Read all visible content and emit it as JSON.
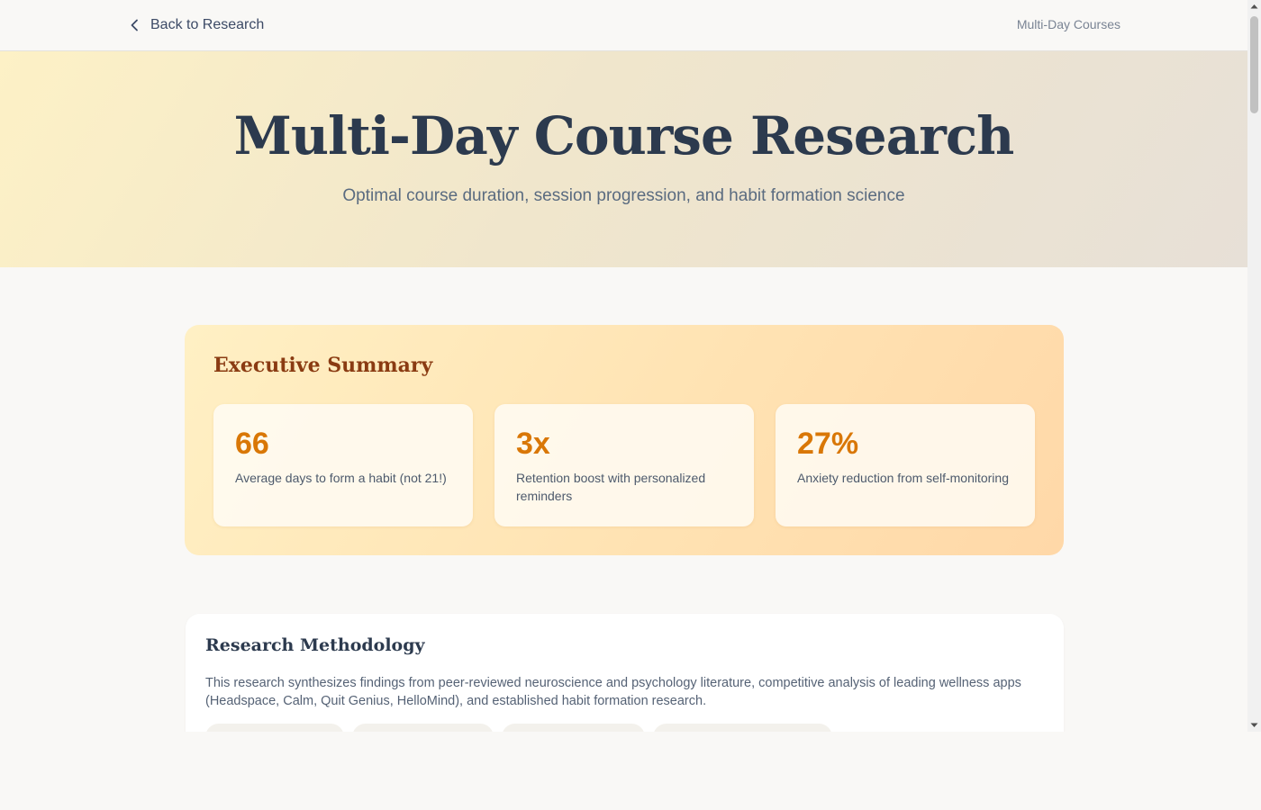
{
  "nav": {
    "back_label": "Back to Research",
    "breadcrumb": "Multi-Day Courses"
  },
  "hero": {
    "title": "Multi-Day Course Research",
    "subtitle": "Optimal course duration, session progression, and habit formation science"
  },
  "summary": {
    "heading": "Executive Summary",
    "stats": [
      {
        "value": "66",
        "label": "Average days to form a habit (not 21!)"
      },
      {
        "value": "3x",
        "label": "Retention boost with personalized reminders"
      },
      {
        "value": "27%",
        "label": "Anxiety reduction from self-monitoring"
      }
    ]
  },
  "methodology": {
    "heading": "Research Methodology",
    "text": "This research synthesizes findings from peer-reviewed neuroscience and psychology literature, competitive analysis of leading wellness apps (Headspace, Calm, Quit Genius, HelloMind), and established habit formation research."
  },
  "colors": {
    "accent": "#d97706",
    "summary_heading": "#8a3b12",
    "title": "#2c3a4e"
  },
  "icons": {
    "back": "chevron-left-icon"
  }
}
